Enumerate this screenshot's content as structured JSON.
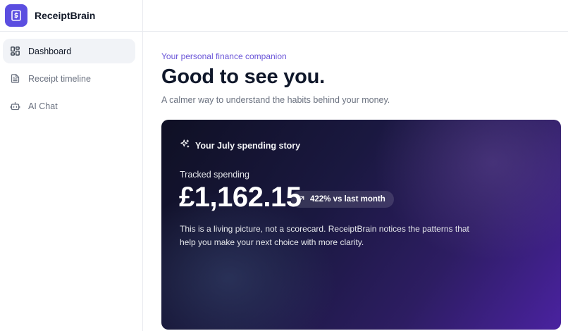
{
  "app": {
    "name": "ReceiptBrain"
  },
  "sidebar": {
    "items": [
      {
        "label": "Dashboard",
        "icon": "dashboard-grid-icon",
        "active": true
      },
      {
        "label": "Receipt timeline",
        "icon": "document-icon",
        "active": false
      },
      {
        "label": "AI Chat",
        "icon": "robot-icon",
        "active": false
      }
    ]
  },
  "main": {
    "eyebrow": "Your personal finance companion",
    "headline": "Good to see you.",
    "subline": "A calmer way to understand the habits behind your money.",
    "story": {
      "title": "Your July spending story",
      "tracked_label": "Tracked spending",
      "amount": "£1,162.15",
      "delta": "422% vs last month",
      "description": "This is a living picture, not a scorecard. ReceiptBrain notices the patterns that help you make your next choice with more clarity."
    }
  },
  "colors": {
    "brand": "#5b4ee0",
    "eyebrow": "#6a55d8",
    "card_start": "#0f1024",
    "card_end": "#4a22a0"
  }
}
